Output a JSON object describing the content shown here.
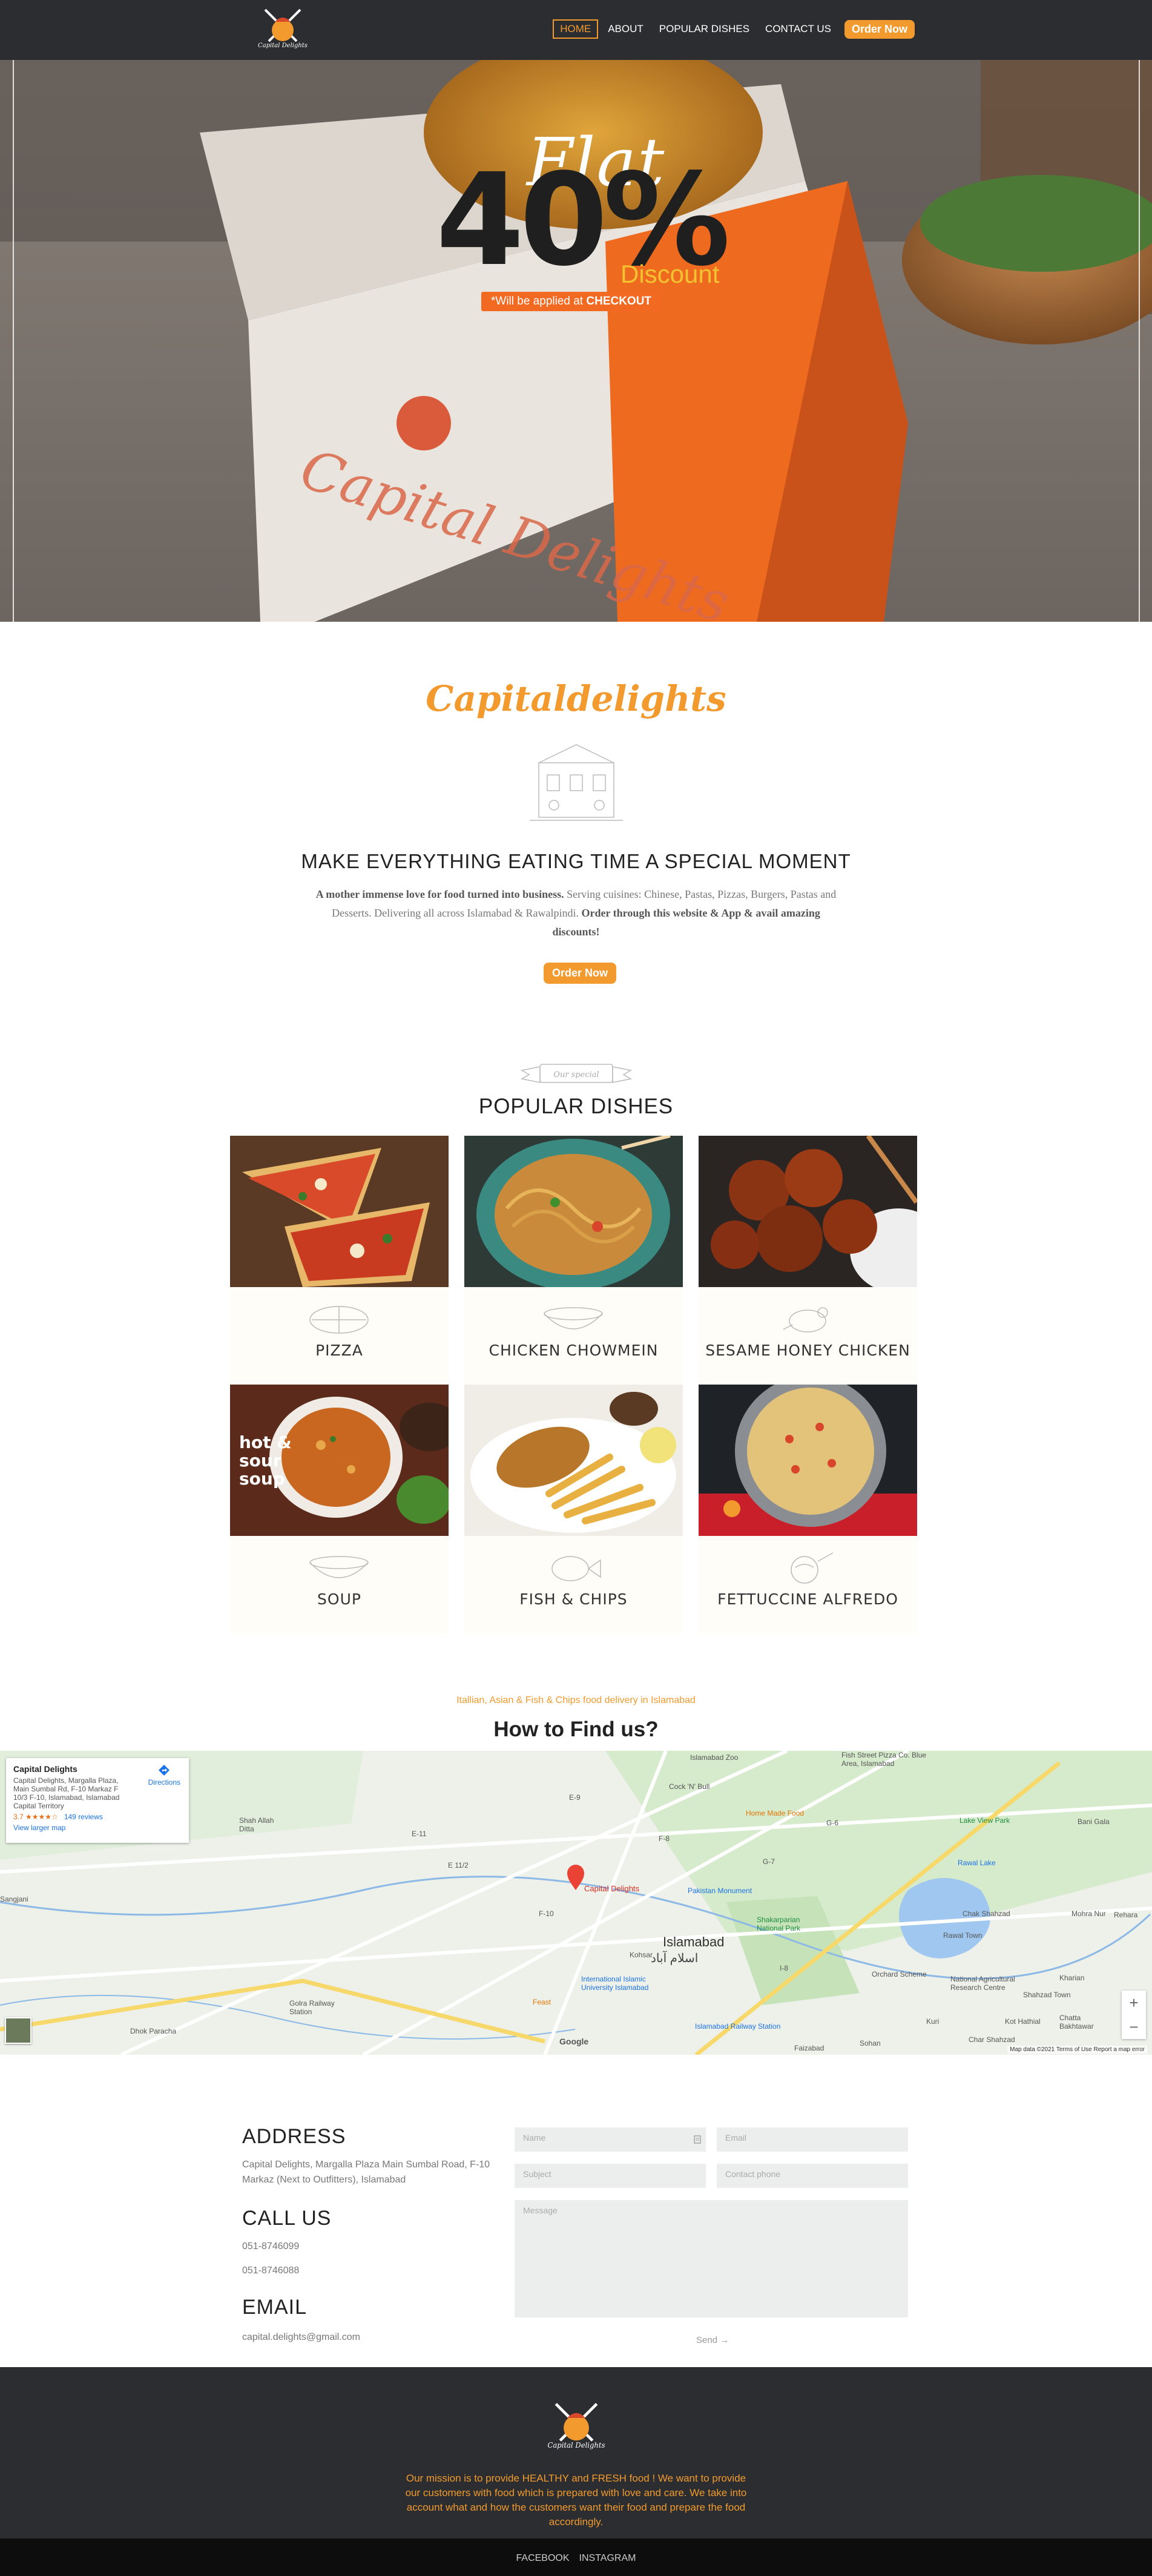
{
  "nav": {
    "logo_text": "Capital Delights",
    "links": [
      {
        "label": "HOME"
      },
      {
        "label": "ABOUT"
      },
      {
        "label": "POPULAR DISHES"
      },
      {
        "label": "CONTACT US"
      }
    ],
    "order_label": "Order Now"
  },
  "hero": {
    "flat": "Flat",
    "percent": "40%",
    "discount": "Discount",
    "note_prefix": "*Will be applied at ",
    "note_strong": "CHECKOUT",
    "box_text": "Capital Delights"
  },
  "about": {
    "brand": "Capitaldelights",
    "heading": "MAKE EVERYTHING EATING TIME A SPECIAL MOMENT",
    "text_strong1": "A mother immense love for food turned into business.",
    "text_middle": " Serving cuisines: Chinese, Pastas, Pizzas, Burgers, Pastas and Desserts. Delivering all across Islamabad & Rawalpindi. ",
    "text_strong2": "Order through this website & App & avail amazing discounts!",
    "order_label": "Order Now"
  },
  "popular": {
    "ribbon": "Our special",
    "heading": "POPULAR DISHES",
    "dishes": [
      {
        "name": "Pizza",
        "sketch": "pizza-sketch"
      },
      {
        "name": "Chicken Chowmein",
        "sketch": "bowl-sketch"
      },
      {
        "name": "Sesame Honey Chicken",
        "sketch": "chicken-sketch"
      },
      {
        "name": "Soup",
        "sketch": "bowl-sketch",
        "overlay": "hot & sour soup"
      },
      {
        "name": "Fish & Chips",
        "sketch": "fish-sketch"
      },
      {
        "name": "Fettuccine Alfredo",
        "sketch": "pasta-sketch"
      }
    ]
  },
  "findus": {
    "subtitle": "Itallian, Asian & Fish & Chips food delivery in Islamabad",
    "heading": "How to Find us?"
  },
  "map": {
    "card_title": "Capital Delights",
    "card_address": "Capital Delights, Margalla Plaza, Main Sumbal Rd, F-10 Markaz F 10/3 F-10, Islamabad, Islamabad Capital Territory",
    "rating": "3.7",
    "stars": "★★★★☆",
    "reviews": "149 reviews",
    "larger_map": "View larger map",
    "directions": "Directions",
    "pin_label": "Capital Delights",
    "city": "Islamabad",
    "city_urdu": "اسلام آباد",
    "labels": [
      "Islamabad Zoo",
      "Fish Street Pizza Co. Blue Area, Islamabad",
      "Cock 'N' Bull",
      "Home Made Food",
      "Lake View Park",
      "Rawal Lake",
      "Pakistan Monument",
      "Shakarparian National Park",
      "E-9",
      "E-11",
      "E 11/2",
      "F-8",
      "F-10",
      "G-6",
      "G-7",
      "I-8",
      "Bani Gala",
      "Chak Shahzad",
      "Mohra Nur",
      "Rehara",
      "Shah Allah Ditta",
      "Golra Railway Station",
      "International Islamic University Islamabad",
      "Islamabad Railway Station",
      "Faizabad",
      "Dhok Paracha",
      "Sangjani",
      "Kharian",
      "Rawal Town",
      "Orchard Scheme",
      "National Agricultural Research Centre",
      "Shahzad Town",
      "Chatta Bakhtawar",
      "Sohan",
      "Char Shahzad",
      "Feast",
      "Kot Hathial",
      "Kuri",
      "Kohsar"
    ],
    "google": "Google",
    "footer_text": "Map data ©2021   Terms of Use   Report a map error",
    "zoom_in": "+",
    "zoom_out": "−"
  },
  "contact": {
    "address_heading": "ADDRESS",
    "address_text": "Capital Delights, Margalla Plaza Main Sumbal Road, F-10 Markaz (Next to Outfitters), Islamabad",
    "call_heading": "CALL US",
    "phone1": "051-8746099",
    "phone2": "051-8746088",
    "email_heading": "EMAIL",
    "email": "capital.delights@gmail.com",
    "form": {
      "name_placeholder": "Name",
      "email_placeholder": "Email",
      "subject_placeholder": "Subject",
      "phone_placeholder": "Contact phone",
      "message_placeholder": "Message",
      "send_label": "Send →"
    }
  },
  "footer": {
    "mission": "Our mission is to provide HEALTHY and FRESH food ! We want to provide our customers with food which is prepared with love and care. We take into account what and how the customers want their food and prepare the food accordingly.",
    "links": [
      {
        "label": "FACEBOOK"
      },
      {
        "label": "INSTAGRAM"
      }
    ]
  },
  "colors": {
    "accent": "#f29a2e",
    "dark": "#2b2d30",
    "hero_orange": "#f26a22"
  }
}
